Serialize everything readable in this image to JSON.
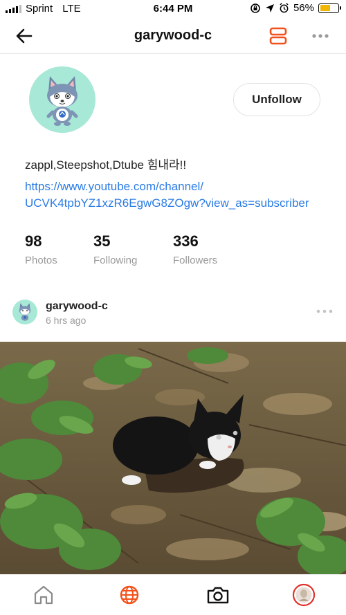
{
  "status_bar": {
    "carrier": "Sprint",
    "network": "LTE",
    "time": "6:44 PM",
    "battery": "56%",
    "battery_level": 0.56,
    "battery_color": "#f2b705"
  },
  "header": {
    "title": "garywood-c",
    "back_icon": "arrow-left-icon",
    "layout_icon": "layout-toggle-icon",
    "more_icon": "more-dots-icon",
    "accent": "#f2511b"
  },
  "profile": {
    "avatar_icon": "husky-avatar-icon",
    "action_label": "Unfollow",
    "bio": "zappl,Steepshot,Dtube 힘내라!!",
    "link_line1": "https://www.youtube.com/channel/",
    "link_line2": "UCVK4tpbYZ1xzR6EgwG8ZOgw?view_as=subscriber",
    "link_color": "#2a7be4",
    "stats": [
      {
        "value": "98",
        "label": "Photos"
      },
      {
        "value": "35",
        "label": "Following"
      },
      {
        "value": "336",
        "label": "Followers"
      }
    ]
  },
  "post": {
    "username": "garywood-c",
    "time": "6 hrs ago",
    "photo_subject": "black-and-white-kitten-photo"
  },
  "tabbar": {
    "items": [
      {
        "icon": "home-icon"
      },
      {
        "icon": "globe-icon",
        "active": true
      },
      {
        "icon": "camera-icon"
      },
      {
        "icon": "profile-avatar-icon"
      }
    ]
  }
}
